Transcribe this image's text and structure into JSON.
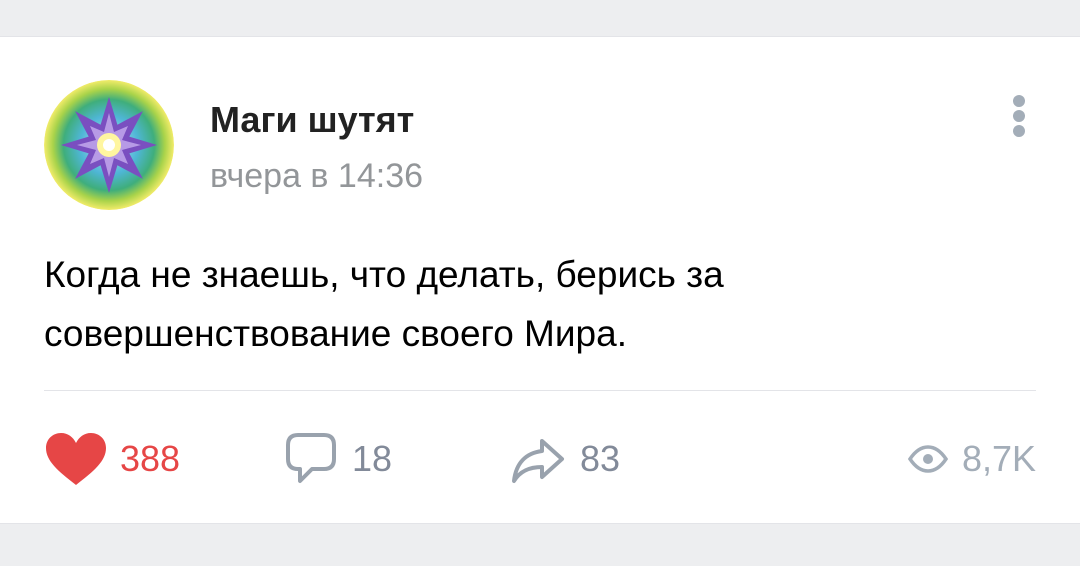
{
  "post": {
    "author": "Маги шутят",
    "time": "вчера в 14:36",
    "text": "Когда не знаешь, что делать, берись за совершенствование своего Мира.",
    "avatar_icon": "mandala-star-icon",
    "more_icon": "vertical-dots-icon"
  },
  "actions": {
    "likes": "388",
    "comments": "18",
    "shares": "83",
    "views": "8,7K",
    "liked": true
  },
  "colors": {
    "like": "#e64646",
    "counter": "#828a99",
    "views": "#a3adb8",
    "background": "#edeef0",
    "card": "#ffffff"
  }
}
